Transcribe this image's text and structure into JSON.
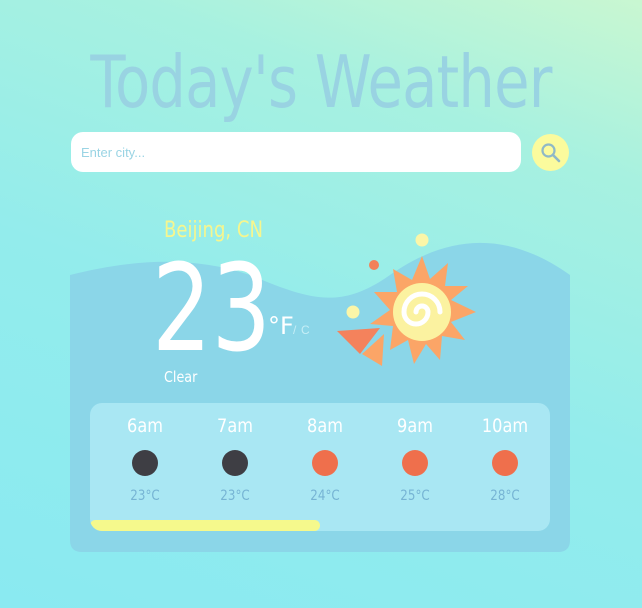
{
  "app": {
    "title": "Today's Weather"
  },
  "search": {
    "placeholder": "Enter city..."
  },
  "current": {
    "location": "Beijing, CN",
    "temperature": "23",
    "unit_f": "°F",
    "unit_separator": "/",
    "unit_c": "C",
    "condition": "Clear"
  },
  "hourly": [
    {
      "time": "6am",
      "temp": "23°C",
      "icon": "night-dot",
      "color": "#3e3e44"
    },
    {
      "time": "7am",
      "temp": "23°C",
      "icon": "night-dot",
      "color": "#3e3e44"
    },
    {
      "time": "8am",
      "temp": "24°C",
      "icon": "sun-dot",
      "color": "#ef6f4c"
    },
    {
      "time": "9am",
      "temp": "25°C",
      "icon": "sun-dot",
      "color": "#ef6f4c"
    },
    {
      "time": "10am",
      "temp": "28°C",
      "icon": "sun-dot",
      "color": "#ef6f4c"
    }
  ],
  "day_progress": 0.5,
  "colors": {
    "title": "#99d3e2",
    "accent_yellow": "#f5f98c",
    "card": "#8bd6e8",
    "forecast_panel": "#a9e7f3",
    "sun_orange": "#fba567"
  },
  "icons": {
    "search": "search-icon",
    "weather": "sun-icon"
  }
}
